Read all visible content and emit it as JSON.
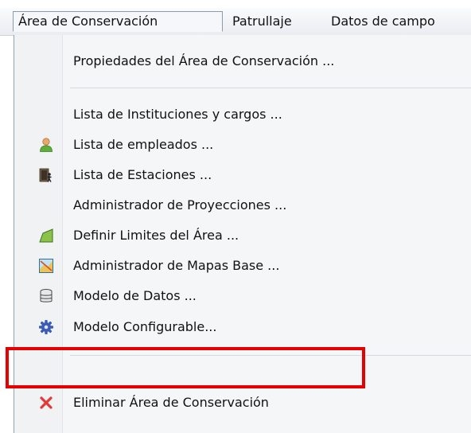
{
  "menubar": {
    "items": [
      {
        "label": "Área de Conservación"
      },
      {
        "label": "Patrullaje"
      },
      {
        "label": "Datos de campo"
      }
    ]
  },
  "menu": {
    "items": [
      {
        "label": "Propiedades del Área de Conservación ...",
        "icon": ""
      },
      {
        "label": "Lista de Instituciones y cargos ...",
        "icon": ""
      },
      {
        "label": "Lista de empleados ...",
        "icon": "employee-icon"
      },
      {
        "label": "Lista de Estaciones ...",
        "icon": "station-icon"
      },
      {
        "label": "Administrador de Proyecciones ...",
        "icon": ""
      },
      {
        "label": "Definir Limites del Área ...",
        "icon": "area-boundary-icon"
      },
      {
        "label": "Administrador de Mapas Base ...",
        "icon": "basemap-icon"
      },
      {
        "label": "Modelo de Datos ...",
        "icon": "database-icon"
      },
      {
        "label": "Modelo Configurable...",
        "icon": "gear-icon"
      },
      {
        "label": "Eliminar Área de Conservación",
        "icon": "delete-icon"
      }
    ]
  },
  "colors": {
    "highlight_border": "#e60000",
    "delete_icon": "#e53935",
    "gear_icon": "#3b5bb5"
  }
}
